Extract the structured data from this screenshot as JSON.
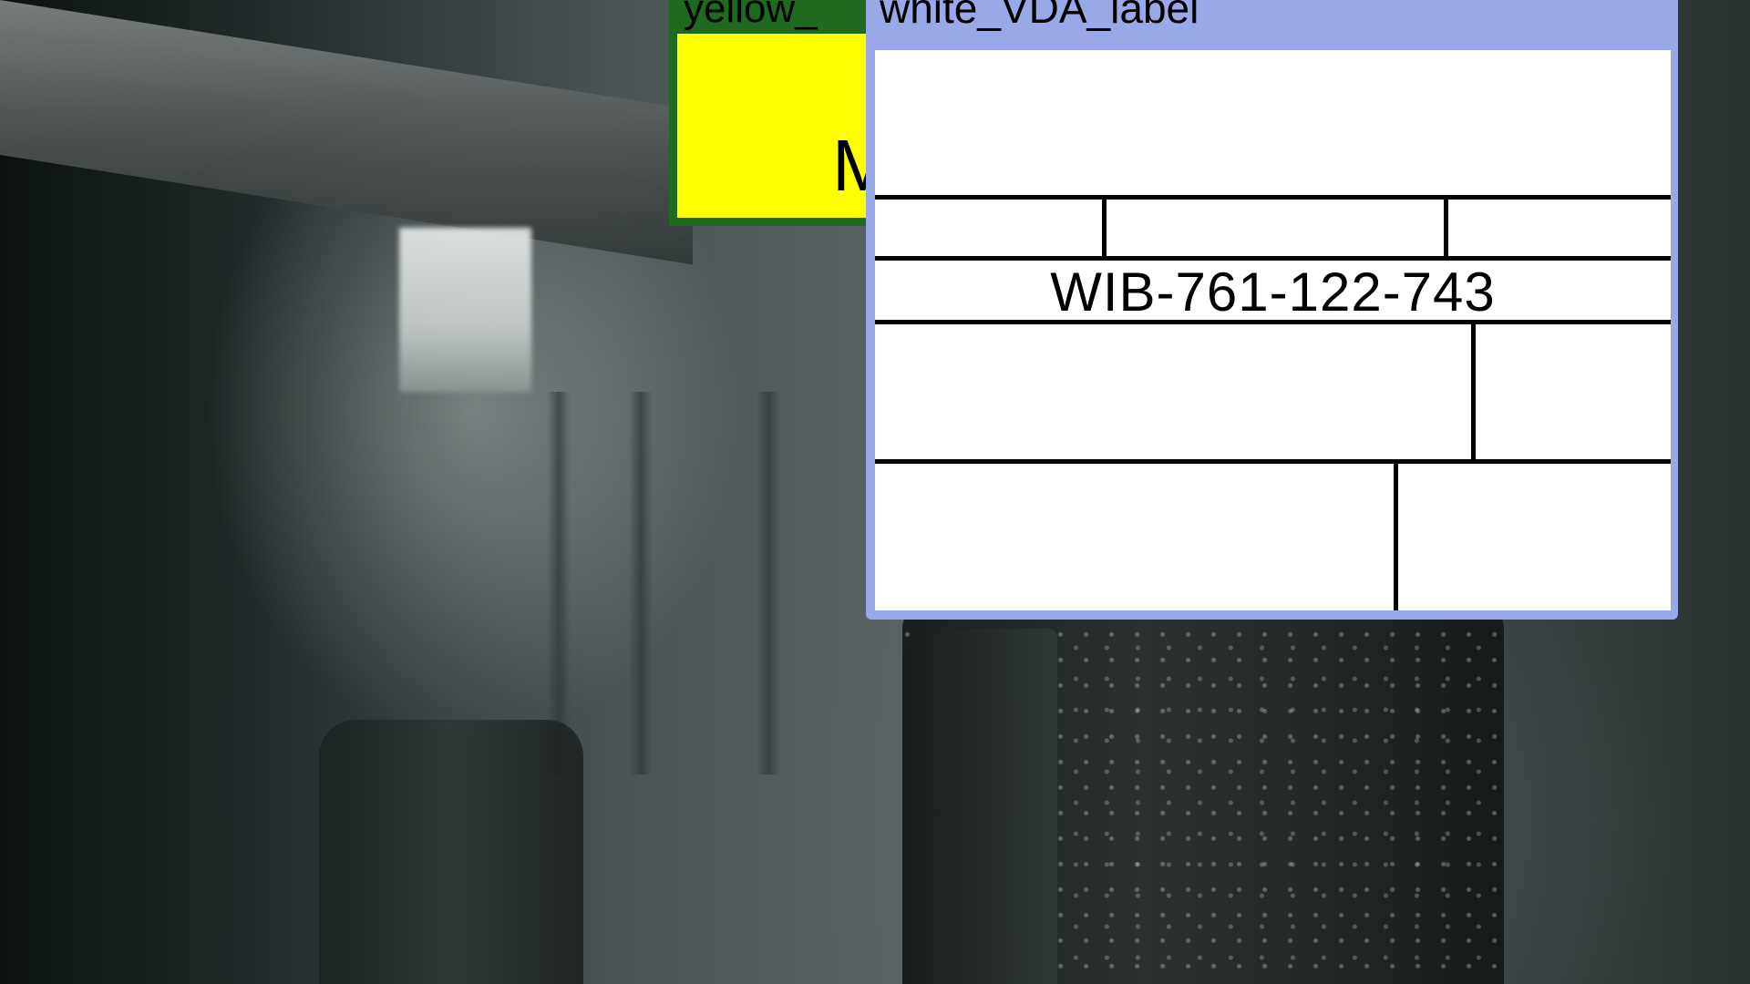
{
  "yellow_label": {
    "title": "yellow_",
    "body_text": "M",
    "colors": {
      "frame": "#1e6a1e",
      "body": "#ffff00"
    }
  },
  "white_label": {
    "title": "white_VDA_label",
    "code": "WIB-761-122-743",
    "colors": {
      "frame": "#99a8e6",
      "body": "#ffffff",
      "grid": "#000000"
    }
  },
  "background": {
    "description_icon": "photo-backdrop"
  }
}
